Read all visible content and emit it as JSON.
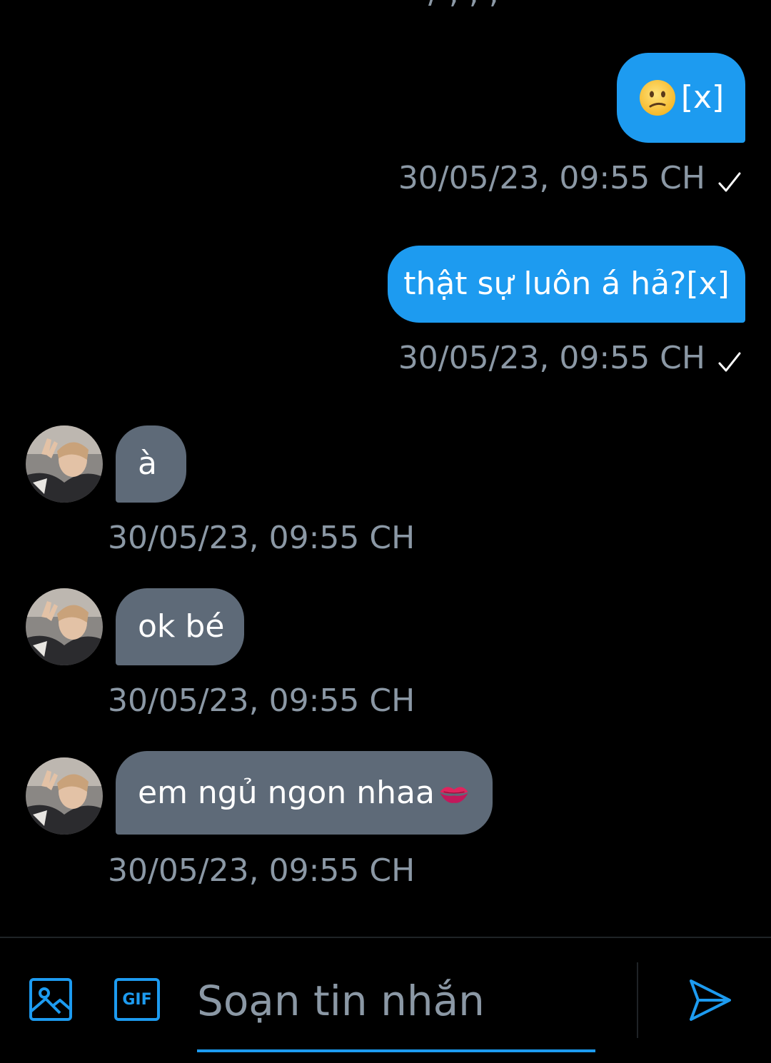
{
  "top_fragment": "/ , , ,",
  "colors": {
    "background": "#000000",
    "outgoing_bubble": "#1d9bf0",
    "incoming_bubble": "#5e6a78",
    "timestamp": "#8b98a5",
    "accent": "#1d9bf0"
  },
  "messages": [
    {
      "direction": "outgoing",
      "emoji": "confused-face",
      "text": "[x]",
      "timestamp": "30/05/23, 09:55 CH",
      "status_icon": "check-icon"
    },
    {
      "direction": "outgoing",
      "text": "thật sự luôn á hả?[x]",
      "timestamp": "30/05/23, 09:55 CH",
      "status_icon": "check-icon"
    },
    {
      "direction": "incoming",
      "text": "à",
      "timestamp": "30/05/23, 09:55 CH"
    },
    {
      "direction": "incoming",
      "text": "ok bé",
      "timestamp": "30/05/23, 09:55 CH"
    },
    {
      "direction": "incoming",
      "text": "em ngủ ngon nhaa",
      "emoji": "kiss-mark",
      "timestamp": "30/05/23, 09:55 CH"
    }
  ],
  "composer": {
    "placeholder": "Soạn tin nhắn",
    "value": "",
    "image_icon": "image-icon",
    "gif_icon": "gif-icon",
    "gif_label": "GIF",
    "send_icon": "send-icon"
  }
}
